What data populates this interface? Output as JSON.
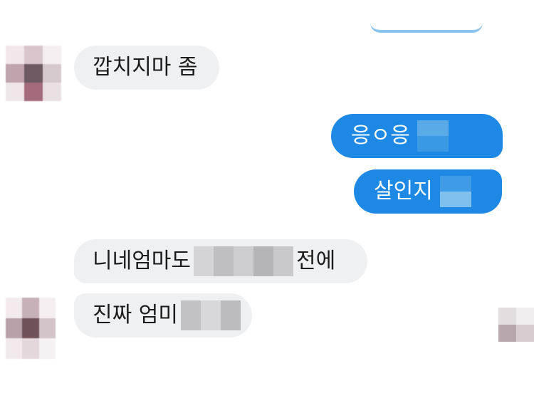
{
  "messages": [
    {
      "text": "깝치지마 좀"
    },
    {
      "text": "응ㅇ응"
    },
    {
      "text": "살인지"
    },
    {
      "text_before": "니네엄마도",
      "text_after": "전에"
    },
    {
      "text": "진짜 엄미"
    }
  ],
  "colors": {
    "background": "#ffffff",
    "incoming_bubble": "#eff0f2",
    "outgoing_bubble": "#1e88e5",
    "incoming_text": "#1c1c1c",
    "outgoing_text": "#ffffff"
  }
}
